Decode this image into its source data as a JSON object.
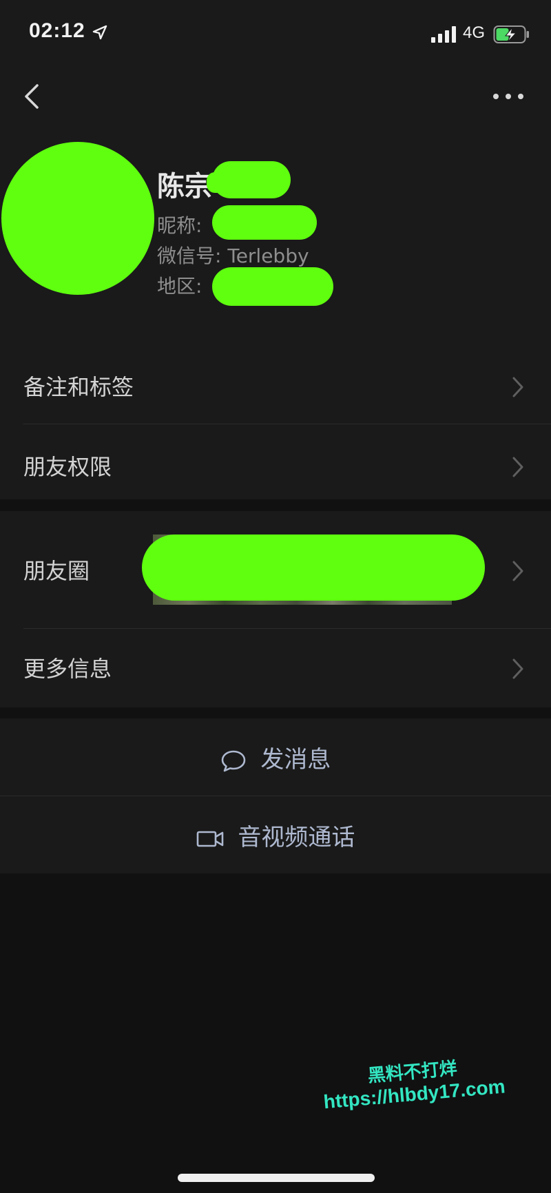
{
  "status_bar": {
    "time": "02:12",
    "network": "4G",
    "icons": [
      "location-icon",
      "signal-icon",
      "battery-charging-icon"
    ]
  },
  "nav": {
    "back_icon": "chevron-left-icon",
    "more_icon": "more-dots-icon"
  },
  "profile": {
    "name": "陈宗",
    "nickname_label": "昵称:",
    "wechat_id_label": "微信号:",
    "wechat_id": "Terlebby",
    "region_label": "地区:"
  },
  "menu": {
    "remarks_tags": "备注和标签",
    "friend_permissions": "朋友权限",
    "moments": "朋友圈",
    "more_info": "更多信息"
  },
  "actions": {
    "send_message": "发消息",
    "voice_video_call": "音视频通话"
  },
  "watermark": {
    "line1": "黑料不打烊",
    "line2": "https://hlbdy17.com"
  },
  "colors": {
    "background": "#111111",
    "surface": "#1a1a1a",
    "redaction": "#5fff0f",
    "action_text": "#aeb9d0",
    "watermark": "#33e6c2"
  }
}
